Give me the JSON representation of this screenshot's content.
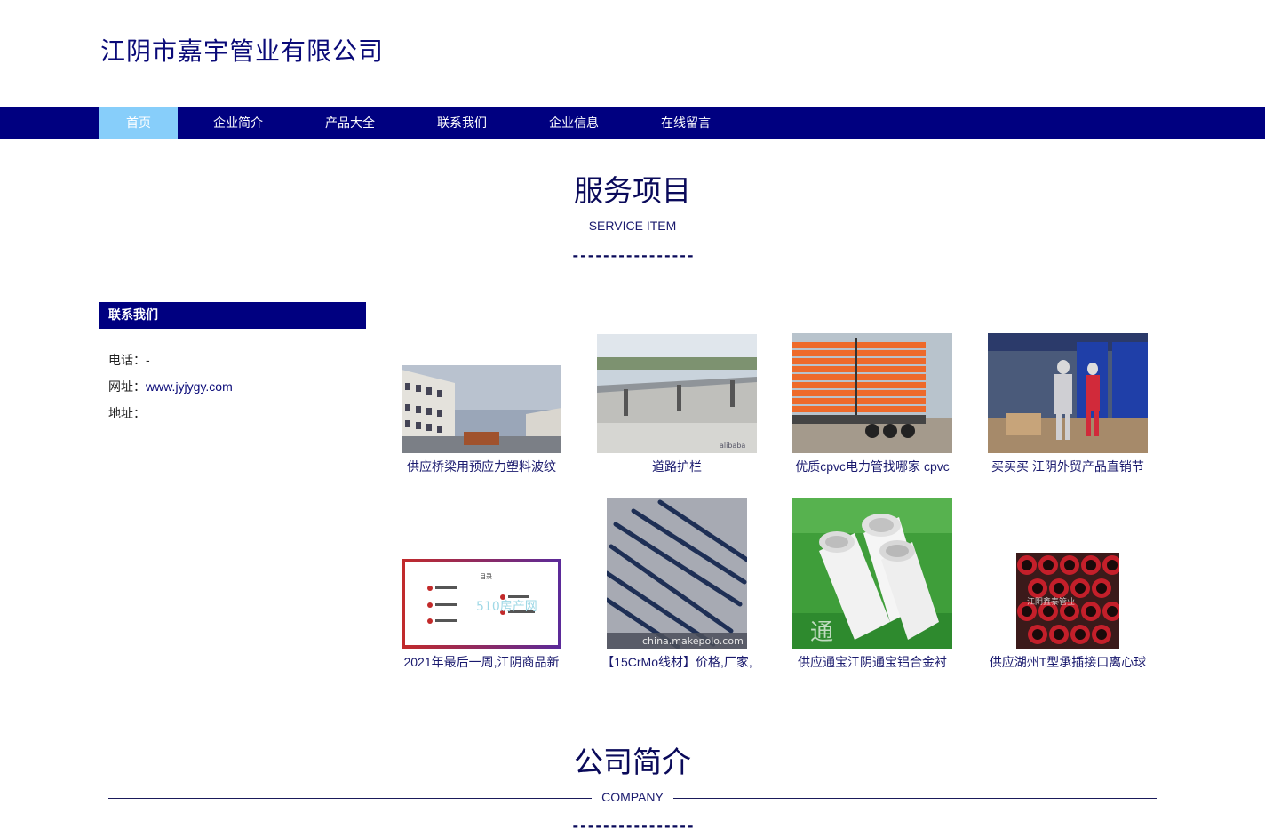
{
  "site": {
    "title": "江阴市嘉宇管业有限公司"
  },
  "nav": {
    "items": [
      {
        "label": "首页",
        "active": true
      },
      {
        "label": "企业简介",
        "active": false
      },
      {
        "label": "产品大全",
        "active": false
      },
      {
        "label": "联系我们",
        "active": false
      },
      {
        "label": "企业信息",
        "active": false
      },
      {
        "label": "在线留言",
        "active": false
      }
    ]
  },
  "services": {
    "title": "服务项目",
    "subtitle": "SERVICE ITEM",
    "dashes": "----------------"
  },
  "contact": {
    "header": "联系我们",
    "phone_label": "电话：",
    "phone_value": "-",
    "website_label": "网址：",
    "website_value": "www.jyjygy.com",
    "address_label": "地址：",
    "address_value": ""
  },
  "products": [
    {
      "caption": "供应桥梁用预应力塑料波纹",
      "image": "factory-building"
    },
    {
      "caption": "道路护栏",
      "image": "road-guardrail"
    },
    {
      "caption": "优质cpvc电力管找哪家 cpvc",
      "image": "orange-pipes-truck"
    },
    {
      "caption": "买买买 江阴外贸产品直销节",
      "image": "expo-mannequins"
    },
    {
      "caption": "2021年最后一周,江阴商品新",
      "image": "report-slide",
      "watermark": "510房产网"
    },
    {
      "caption": "【15CrMo线材】价格,厂家,",
      "image": "steel-rods",
      "watermark": "china.makepolo.com"
    },
    {
      "caption": "供应通宝江阴通宝铝合金衬",
      "image": "white-pipes",
      "watermark": "通"
    },
    {
      "caption": "供应湖州T型承插接口离心球",
      "image": "red-ductile-pipes",
      "watermark": "江阴鑫泰管业"
    }
  ],
  "company": {
    "title": "公司简介",
    "subtitle": "COMPANY",
    "dashes": "----------------"
  },
  "colors": {
    "nav_bg": "#000080",
    "nav_active": "#87cefa",
    "title_color": "#0a0a78"
  }
}
